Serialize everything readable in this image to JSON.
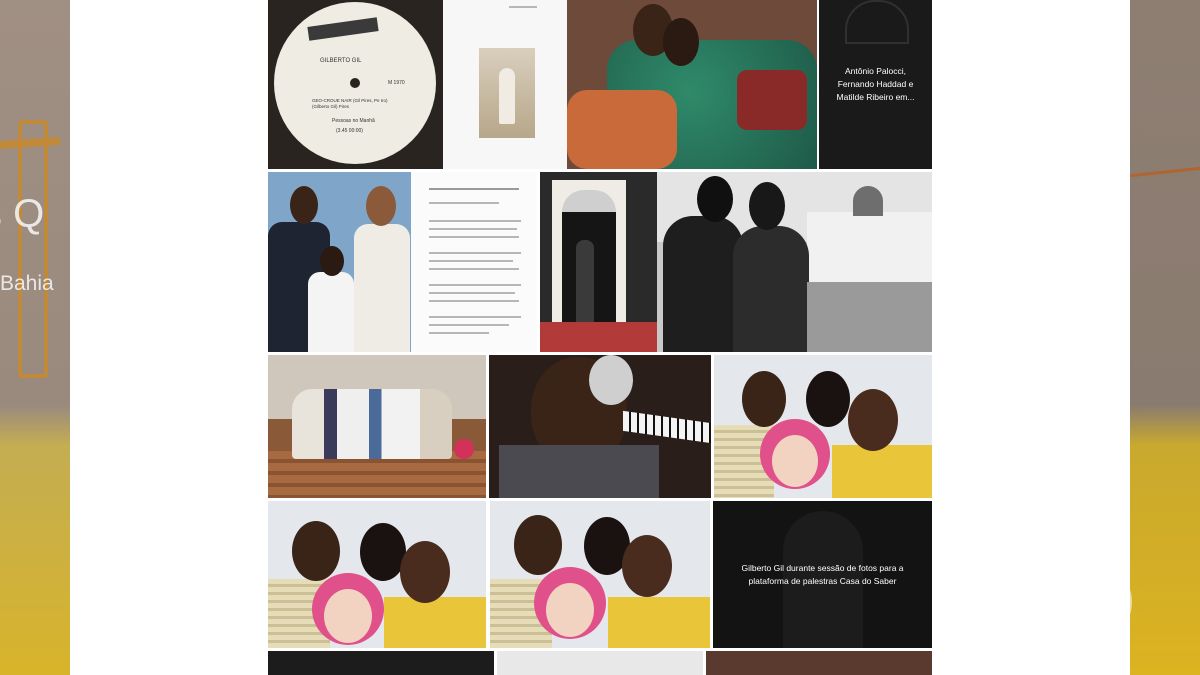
{
  "left_panel": {
    "heading_fragment": "s Q",
    "subtitle_fragment": "Bahia"
  },
  "gallery": {
    "rows": [
      [
        {
          "label": "vinyl-record",
          "caption": "",
          "record_label": {
            "artist": "GILBERTO GIL",
            "side": "SIDE A",
            "catalog": "M 1970",
            "track": "GEO-CROUE NAIR (Gil Pires, Pe Iro) (Gilberto Gil) Pires",
            "album": "Pessoas no Manhã",
            "time": "(3.45 00:00)"
          }
        },
        {
          "label": "document-painting",
          "caption": ""
        },
        {
          "label": "couple-portrait",
          "caption": ""
        },
        {
          "label": "dark-photo-caption",
          "caption": "Antônio Palocci, Fernando Haddad e Matilde Ribeiro em..."
        }
      ],
      [
        {
          "label": "family-portrait",
          "caption": ""
        },
        {
          "label": "text-document",
          "caption": ""
        },
        {
          "label": "doorway-photo",
          "caption": ""
        },
        {
          "label": "london-street-photo",
          "caption": ""
        }
      ],
      [
        {
          "label": "group-on-stairs",
          "caption": ""
        },
        {
          "label": "pianist-portrait",
          "caption": ""
        },
        {
          "label": "three-friends-yellow",
          "caption": ""
        }
      ],
      [
        {
          "label": "three-friends-laughing-1",
          "caption": ""
        },
        {
          "label": "three-friends-laughing-2",
          "caption": ""
        },
        {
          "label": "photoshoot-caption",
          "caption": "Gilberto Gil durante sessão de fotos para a plataforma de palestras Casa do Saber"
        }
      ]
    ]
  },
  "colors": {
    "page_background": "#ffffff",
    "overlay": "#000000",
    "accent_yellow": "#e9c53a",
    "pink_hair": "#e0508a"
  },
  "icons": [
    "globo-logo-icon"
  ]
}
